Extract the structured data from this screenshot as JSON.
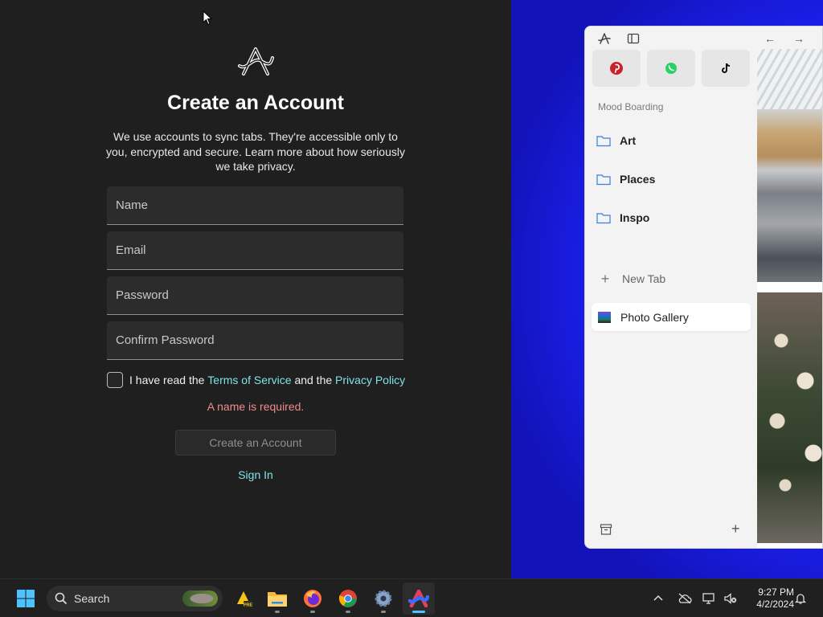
{
  "signup": {
    "title": "Create an Account",
    "description": "We use accounts to sync tabs. They're accessible only to you, encrypted and secure. Learn more about how seriously we take privacy.",
    "name_placeholder": "Name",
    "email_placeholder": "Email",
    "password_placeholder": "Password",
    "confirm_placeholder": "Confirm Password",
    "terms_prefix": "I have read the",
    "terms_link": "Terms of Service",
    "terms_mid": "and the",
    "privacy_link": "Privacy Policy",
    "error": "A name is required.",
    "create_button": "Create an Account",
    "signin_link": "Sign In"
  },
  "arc": {
    "pinned": [
      {
        "name": "pinterest-icon",
        "color": "#c8232c"
      },
      {
        "name": "whatsapp-icon",
        "color": "#25d366"
      },
      {
        "name": "tiktok-icon",
        "color": "#111111"
      }
    ],
    "space_label": "Mood Boarding",
    "folders": [
      "Art",
      "Places",
      "Inspo"
    ],
    "new_tab": "New Tab",
    "active_tab": "Photo Gallery"
  },
  "taskbar": {
    "search_label": "Search",
    "time": "9:27 PM",
    "date": "4/2/2024",
    "apps": [
      "pdf-editor-icon",
      "file-explorer-icon",
      "firefox-icon",
      "chrome-icon",
      "settings-icon",
      "arc-browser-icon"
    ]
  },
  "colors": {
    "accent_link": "#7de3e6",
    "error": "#f08b8b",
    "desktop_blue": "#1a1ee6"
  }
}
